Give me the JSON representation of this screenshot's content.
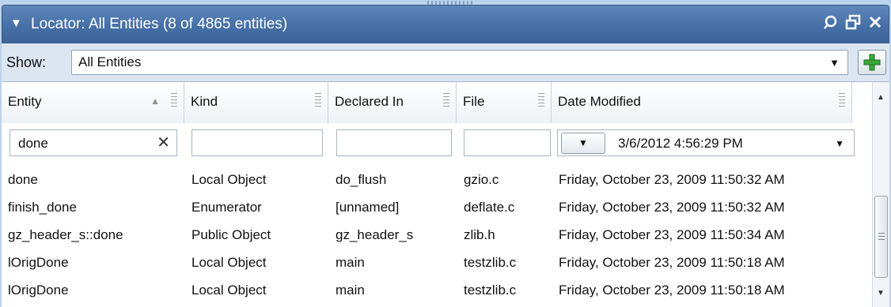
{
  "panel": {
    "title": "Locator: All Entities (8 of 4865 entities)",
    "collapse_icon": "triangle-down-icon",
    "icons": [
      "pin-icon",
      "float-window-icon",
      "close-icon"
    ]
  },
  "show": {
    "label": "Show:",
    "selected": "All Entities",
    "add_icon": "plus-icon"
  },
  "columns": [
    {
      "label": "Entity",
      "sorted": "ascending"
    },
    {
      "label": "Kind"
    },
    {
      "label": "Declared In"
    },
    {
      "label": "File"
    },
    {
      "label": "Date Modified"
    }
  ],
  "filters": {
    "entity": "done",
    "kind": "",
    "declared_in": "",
    "file": "",
    "date": "3/6/2012 4:56:29 PM"
  },
  "rows": [
    {
      "entity": "done",
      "kind": "Local Object",
      "declared_in": "do_flush",
      "file": "gzio.c",
      "date": "Friday, October 23, 2009 11:50:32 AM"
    },
    {
      "entity": "finish_done",
      "kind": "Enumerator",
      "declared_in": "[unnamed]",
      "file": "deflate.c",
      "date": "Friday, October 23, 2009 11:50:32 AM"
    },
    {
      "entity": "gz_header_s::done",
      "kind": "Public Object",
      "declared_in": "gz_header_s",
      "file": "zlib.h",
      "date": "Friday, October 23, 2009 11:50:34 AM"
    },
    {
      "entity": "lOrigDone",
      "kind": "Local Object",
      "declared_in": "main",
      "file": "testzlib.c",
      "date": "Friday, October 23, 2009 11:50:18 AM"
    },
    {
      "entity": "lOrigDone",
      "kind": "Local Object",
      "declared_in": "main",
      "file": "testzlib.c",
      "date": "Friday, October 23, 2009 11:50:18 AM"
    }
  ],
  "colors": {
    "title_bar": "#4670a7",
    "panel_bg": "#dce5f0",
    "accent_plus": "#3aa63a"
  }
}
